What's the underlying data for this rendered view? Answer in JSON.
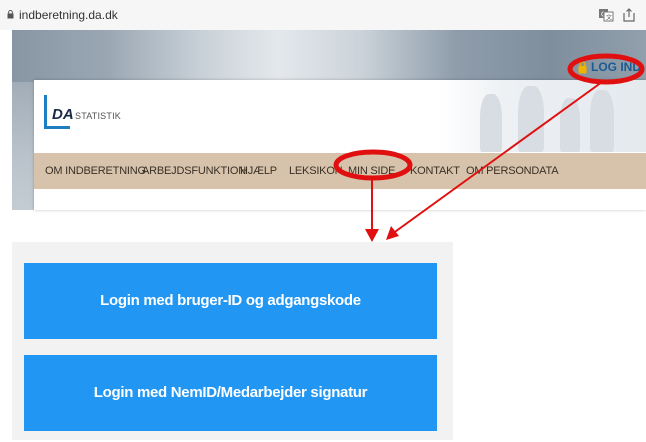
{
  "browser": {
    "url": "indberetning.da.dk",
    "lock_icon": "lock-icon",
    "translate_icon": "translate-icon",
    "share_icon": "share-icon"
  },
  "header": {
    "logo_mark": "DA",
    "logo_text": "STATISTIK",
    "login_label": "LOG IND"
  },
  "nav": {
    "items": [
      {
        "label": "OM INDBERETNING"
      },
      {
        "label": "ARBEJDSFUNKTION"
      },
      {
        "label": "HJÆLP"
      },
      {
        "label": "LEKSIKON"
      },
      {
        "label": "MIN SIDE"
      },
      {
        "label": "KONTAKT"
      },
      {
        "label": "OM PERSONDATA"
      }
    ]
  },
  "login_panel": {
    "button_userid": "Login med bruger-ID og adgangskode",
    "button_nemid": "Login med NemID/Medarbejder signatur"
  },
  "annotations": {
    "highlight_color": "#e01010",
    "arrow_color": "#e01010"
  },
  "colors": {
    "nav_background": "#d7c3ac",
    "button_blue": "#2196f3",
    "link_blue": "#1a5b93"
  }
}
